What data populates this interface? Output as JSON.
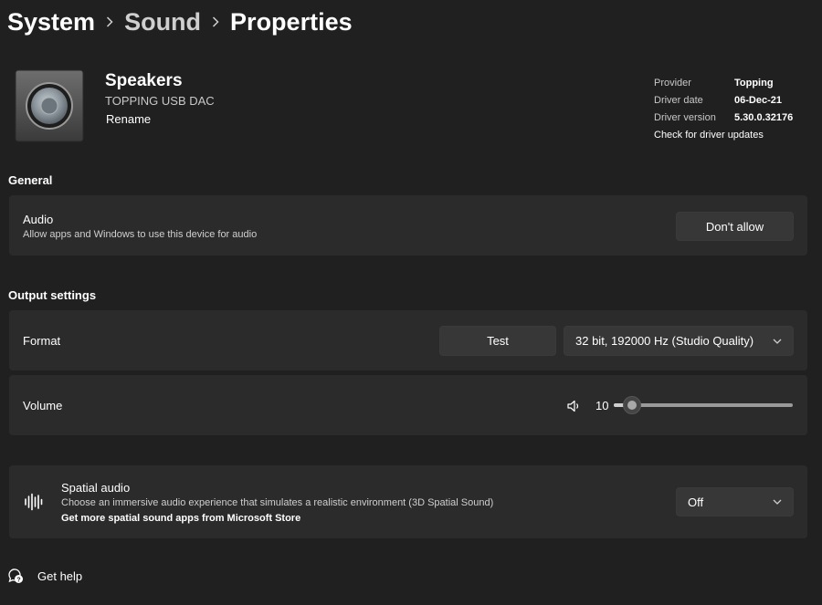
{
  "breadcrumb": {
    "items": [
      "System",
      "Sound",
      "Properties"
    ]
  },
  "device": {
    "name": "Speakers",
    "model": "TOPPING USB DAC",
    "rename_label": "Rename"
  },
  "driver": {
    "provider_label": "Provider",
    "provider_value": "Topping",
    "date_label": "Driver date",
    "date_value": "06-Dec-21",
    "version_label": "Driver version",
    "version_value": "5.30.0.32176",
    "update_link": "Check for driver updates"
  },
  "general": {
    "section_title": "General",
    "audio_title": "Audio",
    "audio_desc": "Allow apps and Windows to use this device for audio",
    "audio_button": "Don't allow"
  },
  "output": {
    "section_title": "Output settings",
    "format_label": "Format",
    "test_button": "Test",
    "format_value": "32 bit, 192000 Hz (Studio Quality)",
    "volume_label": "Volume",
    "volume_value": "10",
    "volume_level": 0.1
  },
  "spatial": {
    "title": "Spatial audio",
    "desc": "Choose an immersive audio experience that simulates a realistic environment (3D Spatial Sound)",
    "store_link": "Get more spatial sound apps from Microsoft Store",
    "value": "Off"
  },
  "help": {
    "label": "Get help"
  },
  "colors": {
    "background": "#202020",
    "card": "#2b2b2b",
    "control": "#373737"
  }
}
